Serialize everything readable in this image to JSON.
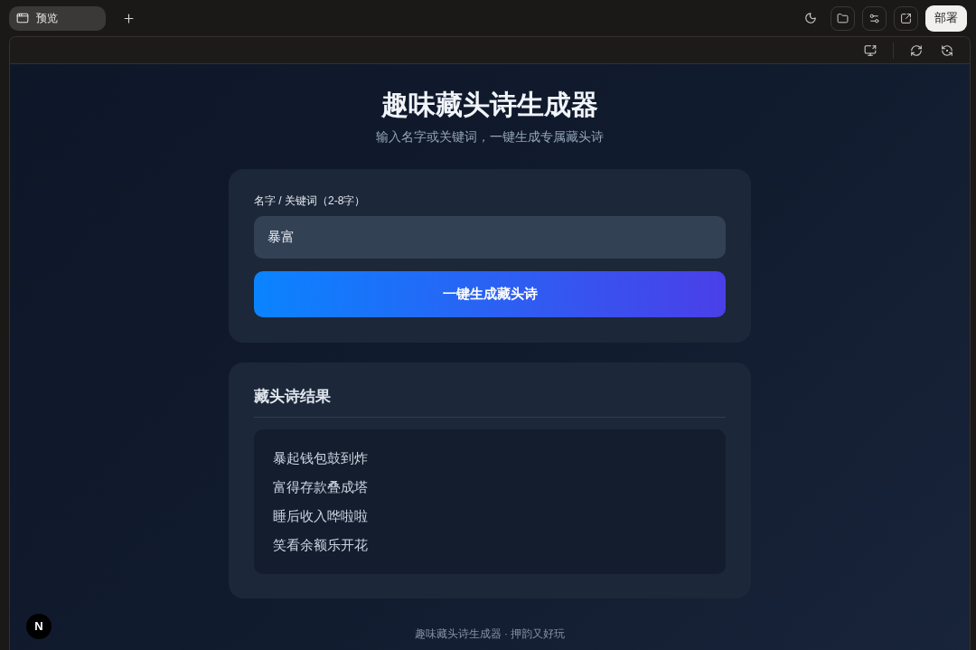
{
  "tabs": [
    {
      "label": "预览",
      "selected": true
    }
  ],
  "deploy_button": {
    "label": "部署"
  },
  "app": {
    "title": "趣味藏头诗生成器",
    "subtitle": "输入名字或关键词，一键生成专属藏头诗",
    "form": {
      "label": "名字 / 关键词（2-8字）",
      "value": "暴富",
      "submit": "一键生成藏头诗"
    },
    "result": {
      "title": "藏头诗结果",
      "lines": [
        "暴起钱包鼓到炸",
        "富得存款叠成塔",
        "睡后收入哗啦啦",
        "笑看余额乐开花"
      ]
    },
    "footer": "趣味藏头诗生成器 · 押韵又好玩"
  },
  "dev_badge": {
    "label": "N"
  }
}
